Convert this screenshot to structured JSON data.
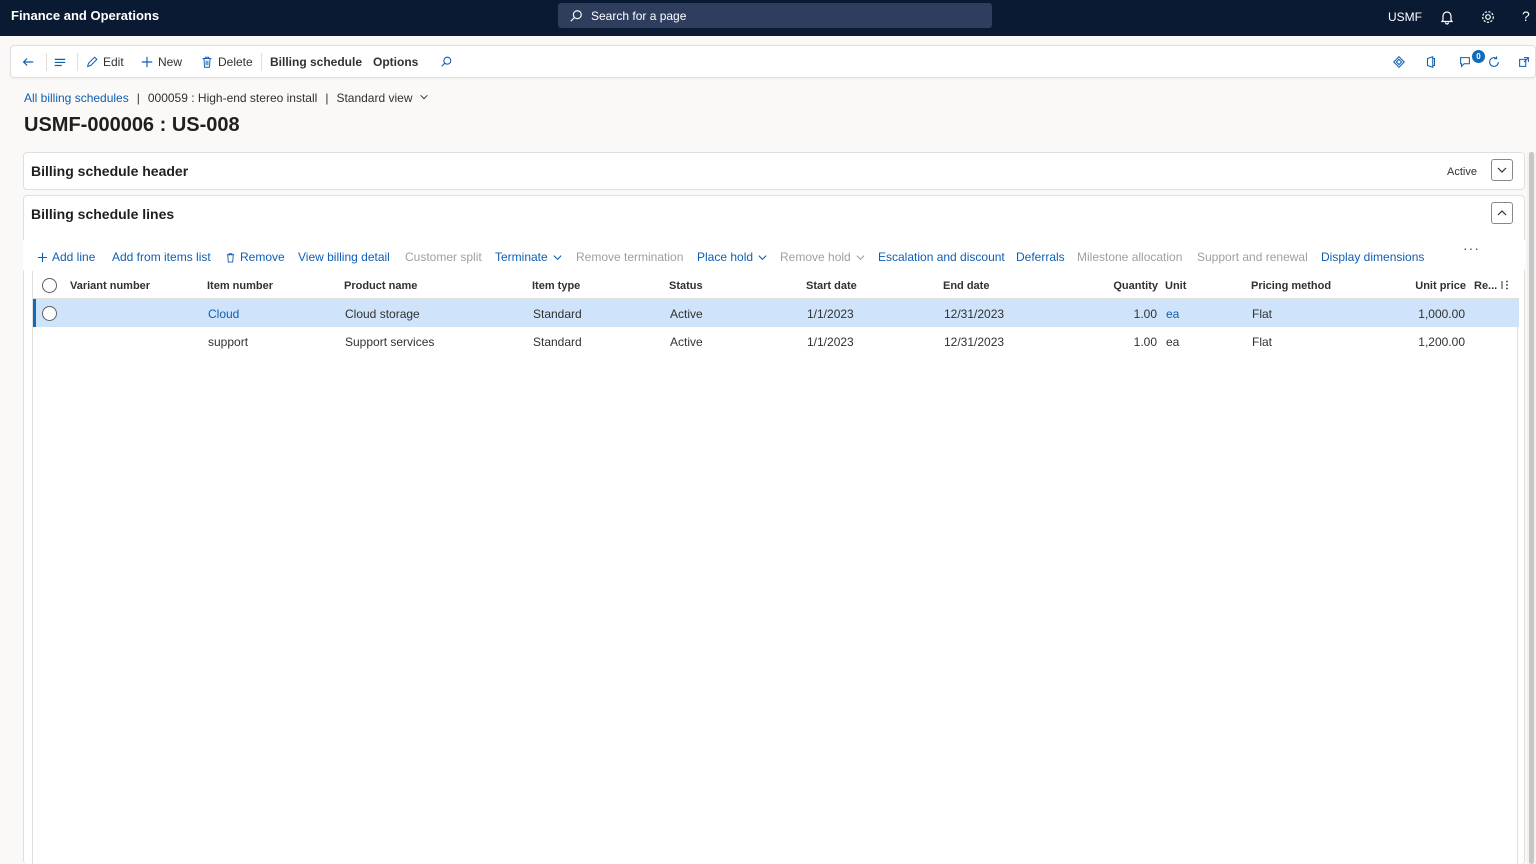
{
  "topbar": {
    "app_name": "Finance and Operations",
    "search_placeholder": "Search for a page",
    "company": "USMF",
    "help": "?"
  },
  "action_pane": {
    "edit": "Edit",
    "new": "New",
    "delete": "Delete",
    "billing_schedule": "Billing schedule",
    "options": "Options",
    "notification_count": "0"
  },
  "breadcrumb": {
    "root": "All billing schedules",
    "record": "000059 : High-end stereo install",
    "view": "Standard view"
  },
  "page_title": "USMF-000006 : US-008",
  "header_tab": {
    "title": "Billing schedule header",
    "status": "Active"
  },
  "lines_tab": {
    "title": "Billing schedule lines"
  },
  "grid_toolbar": {
    "add_line": "Add line",
    "add_from_items": "Add from items list",
    "remove": "Remove",
    "view_billing_detail": "View billing detail",
    "customer_split": "Customer split",
    "terminate": "Terminate",
    "remove_termination": "Remove termination",
    "place_hold": "Place hold",
    "remove_hold": "Remove hold",
    "escalation": "Escalation and discount",
    "deferrals": "Deferrals",
    "milestone": "Milestone allocation",
    "support_renewal": "Support and renewal",
    "display_dimensions": "Display dimensions",
    "more": "···"
  },
  "grid": {
    "columns": {
      "variant": "Variant number",
      "item": "Item number",
      "product": "Product name",
      "item_type": "Item type",
      "status": "Status",
      "start": "Start date",
      "end": "End date",
      "quantity": "Quantity",
      "unit": "Unit",
      "pricing": "Pricing method",
      "unit_price": "Unit price",
      "re": "Re..."
    },
    "rows": [
      {
        "variant": "",
        "item": "Cloud",
        "product": "Cloud storage",
        "item_type": "Standard",
        "status": "Active",
        "start": "1/1/2023",
        "end": "12/31/2023",
        "quantity": "1.00",
        "unit": "ea",
        "pricing": "Flat",
        "unit_price": "1,000.00"
      },
      {
        "variant": "",
        "item": "support",
        "product": "Support services",
        "item_type": "Standard",
        "status": "Active",
        "start": "1/1/2023",
        "end": "12/31/2023",
        "quantity": "1.00",
        "unit": "ea",
        "pricing": "Flat",
        "unit_price": "1,200.00"
      }
    ]
  }
}
